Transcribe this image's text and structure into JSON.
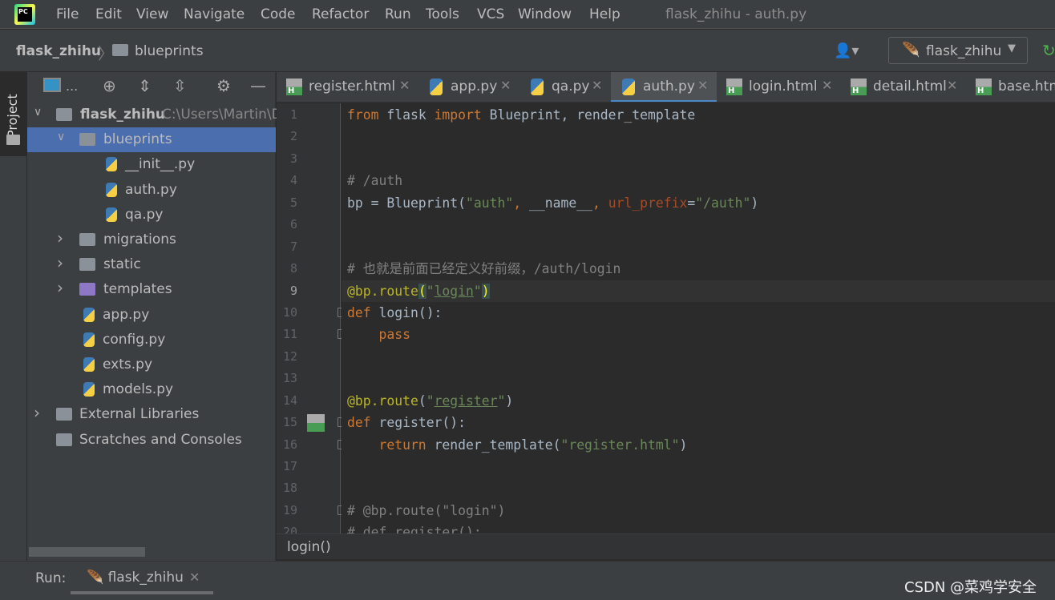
{
  "app": {
    "window_title": "flask_zhihu - auth.py",
    "logo": "PC"
  },
  "menu": [
    "File",
    "Edit",
    "View",
    "Navigate",
    "Code",
    "Refactor",
    "Run",
    "Tools",
    "VCS",
    "Window",
    "Help"
  ],
  "breadcrumb": {
    "project": "flask_zhihu",
    "folder": "blueprints"
  },
  "run_config": {
    "label": "flask_zhihu"
  },
  "left_stripe": {
    "project_tab": "Project"
  },
  "project_tree": {
    "toolbar_label": "...",
    "rows": [
      {
        "label": "flask_zhihu",
        "path": "C:\\Users\\Martin\\D",
        "type": "folder",
        "expanded": true
      },
      {
        "label": "blueprints",
        "type": "package",
        "expanded": true,
        "selected": true
      },
      {
        "label": "__init__.py",
        "type": "py"
      },
      {
        "label": "auth.py",
        "type": "py"
      },
      {
        "label": "qa.py",
        "type": "py"
      },
      {
        "label": "migrations",
        "type": "folder",
        "expanded": false
      },
      {
        "label": "static",
        "type": "folder",
        "expanded": false
      },
      {
        "label": "templates",
        "type": "template-folder",
        "expanded": false
      },
      {
        "label": "app.py",
        "type": "py"
      },
      {
        "label": "config.py",
        "type": "py"
      },
      {
        "label": "exts.py",
        "type": "py"
      },
      {
        "label": "models.py",
        "type": "py"
      },
      {
        "label": "External Libraries",
        "type": "libs",
        "expanded": false
      },
      {
        "label": "Scratches and Consoles",
        "type": "scratch"
      }
    ]
  },
  "tabs": [
    {
      "label": "register.html",
      "type": "html"
    },
    {
      "label": "app.py",
      "type": "py"
    },
    {
      "label": "qa.py",
      "type": "py"
    },
    {
      "label": "auth.py",
      "type": "py",
      "active": true
    },
    {
      "label": "login.html",
      "type": "html"
    },
    {
      "label": "detail.html",
      "type": "html"
    },
    {
      "label": "base.htm",
      "type": "html"
    }
  ],
  "editor": {
    "current_line": 9,
    "lines": [
      [
        [
          "kw",
          "from "
        ],
        [
          "",
          "flask "
        ],
        [
          "kw",
          "import "
        ],
        [
          "",
          "Blueprint, render_template"
        ]
      ],
      [],
      [],
      [
        [
          "cm",
          "# /auth"
        ]
      ],
      [
        [
          "",
          "bp = Blueprint("
        ],
        [
          "str",
          "\"auth\""
        ],
        [
          "kw",
          ", "
        ],
        [
          "",
          "__name__"
        ],
        [
          "kw",
          ", "
        ],
        [
          "kwa",
          "url_prefix"
        ],
        [
          "",
          "="
        ],
        [
          "str",
          "\"/auth\""
        ],
        [
          "",
          ")"
        ]
      ],
      [],
      [],
      [
        [
          "cm",
          "# 也就是前面已经定义好前缀，/auth/login"
        ]
      ],
      [
        [
          "dec",
          "@bp.route"
        ],
        [
          "br",
          "("
        ],
        [
          "str",
          "\""
        ],
        [
          "str ul",
          "login"
        ],
        [
          "str",
          "\""
        ],
        [
          "br",
          ")"
        ]
      ],
      [
        [
          "kw",
          "def "
        ],
        [
          "",
          "login():"
        ]
      ],
      [
        [
          "kw",
          "    pass"
        ]
      ],
      [],
      [],
      [
        [
          "dec",
          "@bp.route"
        ],
        [
          "",
          "("
        ],
        [
          "str",
          "\""
        ],
        [
          "str ul",
          "register"
        ],
        [
          "str",
          "\""
        ],
        [
          "",
          ")"
        ]
      ],
      [
        [
          "kw",
          "def "
        ],
        [
          "",
          "register():"
        ]
      ],
      [
        [
          "kw",
          "    return "
        ],
        [
          "",
          "render_template("
        ],
        [
          "str",
          "\"register.html\""
        ],
        [
          "",
          ")"
        ]
      ],
      [],
      [],
      [
        [
          "cm",
          "# @bp.route(\"login\")"
        ]
      ],
      [
        [
          "cm",
          "# def register():"
        ]
      ]
    ]
  },
  "code_breadcrumb": "login()",
  "run_panel": {
    "label": "Run:",
    "tab": "flask_zhihu"
  },
  "watermark": "CSDN @菜鸡学安全",
  "colors": {
    "selection": "#4b6eaf",
    "keyword": "#cc7832",
    "string": "#6a8759",
    "comment": "#808080",
    "decorator": "#bbb529"
  }
}
